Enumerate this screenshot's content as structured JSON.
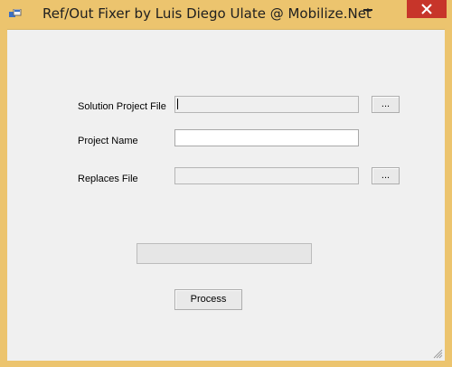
{
  "window": {
    "title": "Ref/Out Fixer by Luis Diego Ulate @ Mobilize.Net",
    "controls": {
      "minimize": "minimize",
      "close": "close"
    }
  },
  "form": {
    "solution_label": "Solution Project File",
    "solution_value": "",
    "solution_browse": "...",
    "project_label": "Project Name",
    "project_value": "",
    "replaces_label": "Replaces File",
    "replaces_value": "",
    "replaces_browse": "..."
  },
  "progress": {
    "value": 0
  },
  "actions": {
    "process_label": "Process"
  },
  "colors": {
    "titlebar": "#ecc46e",
    "close": "#c7352a",
    "client": "#f0f0f0"
  },
  "icons": {
    "app": "app-icon",
    "minimize": "minimize-icon",
    "close": "close-icon",
    "resize": "resize-grip-icon"
  }
}
